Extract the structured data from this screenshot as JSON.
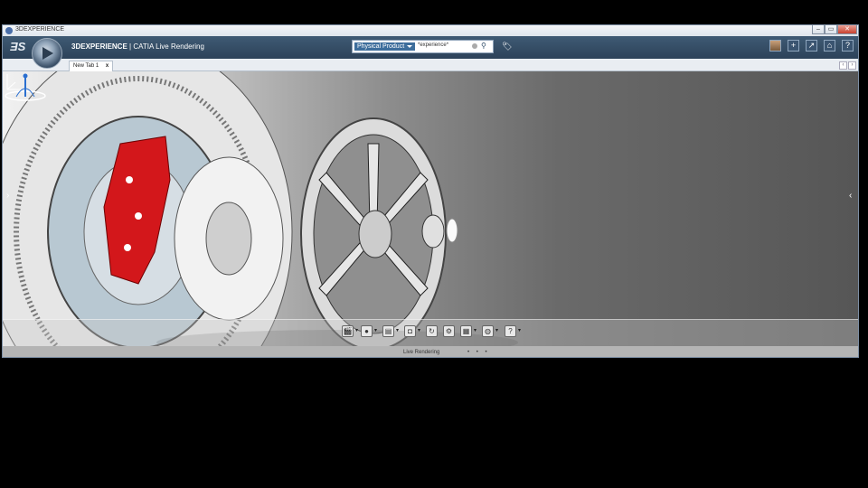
{
  "window": {
    "title": "3DEXPERIENCE",
    "minimize_label": "–",
    "maximize_label": "▭",
    "close_label": "✕"
  },
  "appbar": {
    "logo_text": "ƎS",
    "title_brand": "3DEXPERIENCE",
    "title_app": "| CATIA Live Rendering",
    "search_category": "Physical Product",
    "search_value": "*experience*",
    "search_icon": "⚲",
    "tag_icon": "🏷",
    "actions": [
      {
        "name": "add",
        "glyph": "+"
      },
      {
        "name": "share",
        "glyph": "↗"
      },
      {
        "name": "home",
        "glyph": "⌂"
      },
      {
        "name": "help",
        "glyph": "?"
      }
    ]
  },
  "tabs": [
    {
      "label": "New Tab 1",
      "close": "x"
    }
  ],
  "tab_arrows": {
    "prev": "‹",
    "next": "›"
  },
  "viewport": {
    "left_arrow": "›",
    "right_arrow": "‹"
  },
  "action_bar": {
    "section_title": "Live Rendering",
    "page_dots": "• • •",
    "tools": [
      {
        "name": "clapperboard",
        "glyph": "🎬",
        "dropdown": true
      },
      {
        "name": "sphere-material",
        "glyph": "●",
        "dropdown": true
      },
      {
        "name": "image-render",
        "glyph": "▤",
        "dropdown": true
      },
      {
        "name": "camera",
        "glyph": "◘",
        "dropdown": true
      },
      {
        "name": "turntable",
        "glyph": "↻",
        "dropdown": false
      },
      {
        "name": "settings",
        "glyph": "⚙",
        "dropdown": false
      },
      {
        "name": "scene-library",
        "glyph": "▦",
        "dropdown": true
      },
      {
        "name": "globe-environment",
        "glyph": "◍",
        "dropdown": true
      },
      {
        "name": "help",
        "glyph": "?",
        "dropdown": true
      }
    ]
  }
}
